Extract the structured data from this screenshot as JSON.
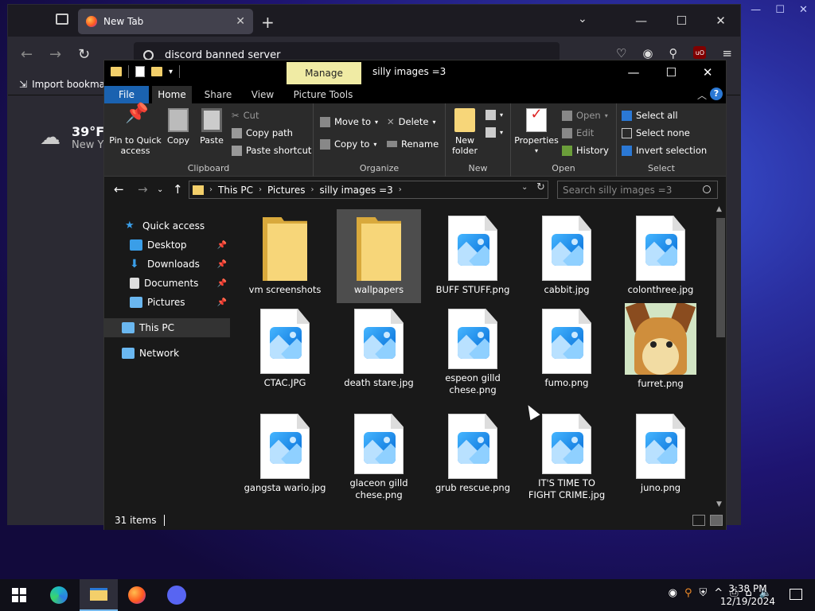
{
  "firefox": {
    "tab_title": "New Tab",
    "url_text": "discord banned server",
    "bookmark_import": "Import bookmar",
    "weather_temp": "39°F",
    "weather_loc": "New Y"
  },
  "explorer": {
    "window_title": "silly images =3",
    "manage_tab": "Manage",
    "tabs": {
      "file": "File",
      "home": "Home",
      "share": "Share",
      "view": "View",
      "picture_tools": "Picture Tools"
    },
    "clipboard": {
      "group": "Clipboard",
      "pin": "Pin to Quick access",
      "copy": "Copy",
      "paste": "Paste",
      "cut": "Cut",
      "copy_path": "Copy path",
      "paste_shortcut": "Paste shortcut"
    },
    "organize": {
      "group": "Organize",
      "move_to": "Move to",
      "copy_to": "Copy to",
      "delete": "Delete",
      "rename": "Rename"
    },
    "new": {
      "group": "New",
      "new_folder": "New folder"
    },
    "open": {
      "group": "Open",
      "properties": "Properties",
      "open": "Open",
      "edit": "Edit",
      "history": "History"
    },
    "select": {
      "group": "Select",
      "select_all": "Select all",
      "select_none": "Select none",
      "invert": "Invert selection"
    },
    "breadcrumb": [
      "This PC",
      "Pictures",
      "silly images =3"
    ],
    "search_placeholder": "Search silly images =3",
    "nav": {
      "quick_access": "Quick access",
      "desktop": "Desktop",
      "downloads": "Downloads",
      "documents": "Documents",
      "pictures": "Pictures",
      "this_pc": "This PC",
      "network": "Network"
    },
    "files": [
      "vm screenshots",
      "wallpapers",
      "BUFF STUFF.png",
      "cabbit.jpg",
      "colonthree.jpg",
      "CTAC.JPG",
      "death stare.jpg",
      "espeon gilld chese.png",
      "fumo.png",
      "furret.png",
      "gangsta wario.jpg",
      "glaceon gilld chese.png",
      "grub rescue.png",
      "IT'S TIME TO FIGHT CRIME.jpg",
      "juno.png"
    ],
    "status_count": "31 items"
  },
  "taskbar": {
    "time": "3:38 PM",
    "date": "12/19/2024"
  }
}
